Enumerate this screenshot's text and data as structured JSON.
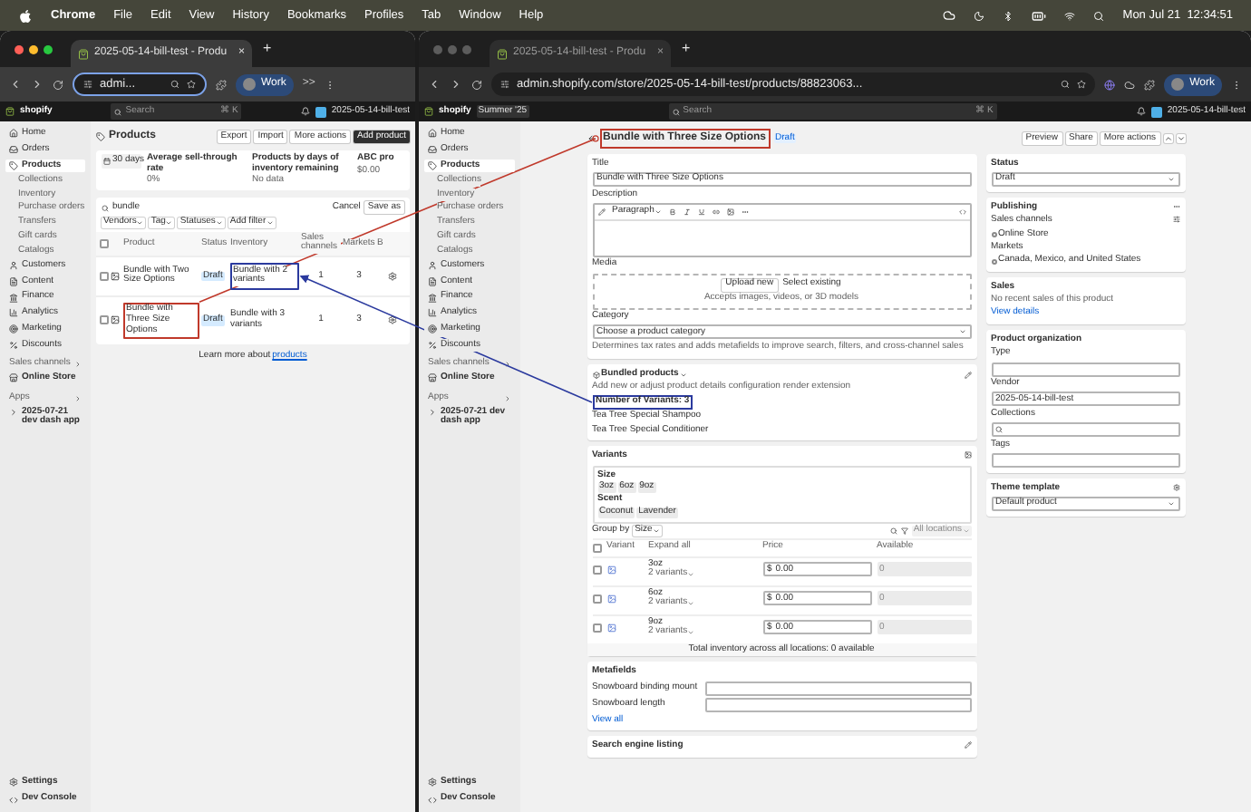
{
  "menu_bar": {
    "app": "Chrome",
    "items": [
      "File",
      "Edit",
      "View",
      "History",
      "Bookmarks",
      "Profiles",
      "Tab",
      "Window",
      "Help"
    ],
    "clock": "Mon Jul 21  12:34:51"
  },
  "left_window": {
    "focused": true,
    "tab_title": "2025-05-14-bill-test - Produ",
    "tab_close": "×",
    "new_tab": "+",
    "address": "admi...",
    "profile": "Work",
    "overflow": ">>",
    "admin_bar": {
      "logo": "shopify",
      "search": "Search",
      "shortcut": "⌘ K",
      "store": "2025-05-14-bill-test"
    },
    "sidebar": {
      "items": [
        {
          "label": "Home",
          "selected": false
        },
        {
          "label": "Orders",
          "selected": false
        },
        {
          "label": "Products",
          "selected": true,
          "children": [
            "Collections",
            "Inventory",
            "Purchase orders",
            "Transfers",
            "Gift cards",
            "Catalogs"
          ]
        },
        {
          "label": "Customers",
          "selected": false
        },
        {
          "label": "Content",
          "selected": false
        },
        {
          "label": "Finance",
          "selected": false
        },
        {
          "label": "Analytics",
          "selected": false
        },
        {
          "label": "Marketing",
          "selected": false
        },
        {
          "label": "Discounts",
          "selected": false
        }
      ],
      "sections": [
        {
          "title": "Sales channels",
          "items": [
            "Online Store"
          ]
        },
        {
          "title": "Apps",
          "items": [
            "2025-07-21 dev dash app"
          ]
        }
      ],
      "footer": [
        "Settings",
        "Dev Console"
      ]
    },
    "page": {
      "title": "Products",
      "actions": [
        "Export",
        "Import",
        "More actions"
      ],
      "primary": "Add product",
      "period": "30 days",
      "metrics": [
        {
          "label": "Average sell-through rate",
          "value": "0%"
        },
        {
          "label": "Products by days of inventory remaining",
          "value": "No data"
        },
        {
          "label": "ABC pro",
          "value": "$0.00"
        }
      ],
      "search": "bundle",
      "cancel": "Cancel",
      "save": "Save as",
      "filters": [
        "Vendors",
        "Tag",
        "Statuses",
        "Add filter"
      ],
      "select_all_checked": false,
      "columns": [
        "Product",
        "Status",
        "Inventory",
        "Sales channels",
        "Markets",
        "B"
      ],
      "rows": [
        {
          "checked": false,
          "product": {
            "text": "Bundle with Two Size Options"
          },
          "status": "Draft",
          "inventory": {
            "text": "Bundle with 2 variants",
            "color": "#2b3a9e"
          },
          "channels": "1",
          "markets": "3"
        },
        {
          "checked": false,
          "product": {
            "text": "Bundle with Three Size Options",
            "color": "#c0392b"
          },
          "status": "Draft",
          "inventory": {
            "text": "Bundle with 3 variants"
          },
          "channels": "1",
          "markets": "3"
        }
      ],
      "footer": "Learn more about",
      "footer_link": "products"
    }
  },
  "right_window": {
    "focused": false,
    "tab_title": "2025-05-14-bill-test - Produ",
    "tab_close": "×",
    "new_tab": "+",
    "address": "admin.shopify.com/store/2025-05-14-bill-test/products/88823063...",
    "profile": "Work",
    "admin_bar": {
      "logo": "shopify",
      "badge": "Summer '25",
      "search": "Search",
      "shortcut": "⌘ K",
      "store": "2025-05-14-bill-test"
    },
    "sidebar": {
      "items": [
        {
          "label": "Home",
          "selected": false
        },
        {
          "label": "Orders",
          "selected": false
        },
        {
          "label": "Products",
          "selected": true,
          "children": [
            "Collections",
            "Inventory",
            "Purchase orders",
            "Transfers",
            "Gift cards",
            "Catalogs"
          ]
        },
        {
          "label": "Customers",
          "selected": false
        },
        {
          "label": "Content",
          "selected": false
        },
        {
          "label": "Finance",
          "selected": false
        },
        {
          "label": "Analytics",
          "selected": false
        },
        {
          "label": "Marketing",
          "selected": false
        },
        {
          "label": "Discounts",
          "selected": false
        }
      ],
      "sections": [
        {
          "title": "Sales channels",
          "items": [
            "Online Store"
          ]
        },
        {
          "title": "Apps",
          "items": [
            "2025-07-21 dev dash app"
          ]
        }
      ],
      "footer": [
        "Settings",
        "Dev Console"
      ]
    },
    "page": {
      "title": {
        "text": "Bundle with Three Size Options",
        "color": "#c0392b"
      },
      "status_badge": "Draft",
      "actions": [
        "Preview",
        "Share",
        "More actions"
      ],
      "title_label": "Title",
      "title_value": "Bundle with Three Size Options",
      "description_label": "Description",
      "editor_style": "Paragraph",
      "media": {
        "label": "Media",
        "upload": "Upload new",
        "select": "Select existing",
        "hint": "Accepts images, videos, or 3D models"
      },
      "category": {
        "label": "Category",
        "placeholder": "Choose a product category",
        "hint": "Determines tax rates and adds metafields to improve search, filters, and cross-channel sales"
      },
      "bundle": {
        "title": "Bundled products",
        "description": "Add new or adjust product details configuration render extension",
        "count": {
          "text": "Number of Variants: 3",
          "color": "#2b3a9e"
        },
        "items": [
          "Tea Tree Special Shampoo",
          "Tea Tree Special Conditioner"
        ]
      },
      "variants": {
        "title": "Variants",
        "options": [
          {
            "name": "Size",
            "values": [
              "3oz",
              "6oz",
              "9oz"
            ]
          },
          {
            "name": "Scent",
            "values": [
              "Coconut",
              "Lavender"
            ]
          }
        ],
        "group_label": "Group by",
        "group_value": "Size",
        "locations": "All locations",
        "select_all_checked": false,
        "columns": [
          "Variant",
          "Expand all",
          "Price",
          "Available"
        ],
        "rows": [
          {
            "checked": false,
            "name": "3oz",
            "count": "2 variants",
            "currency": "$",
            "price": "0.00",
            "available": "0"
          },
          {
            "checked": false,
            "name": "6oz",
            "count": "2 variants",
            "currency": "$",
            "price": "0.00",
            "available": "0"
          },
          {
            "checked": false,
            "name": "9oz",
            "count": "2 variants",
            "currency": "$",
            "price": "0.00",
            "available": "0"
          }
        ],
        "total": "Total inventory across all locations: 0 available"
      },
      "metafields": {
        "title": "Metafields",
        "fields": [
          "Snowboard binding mount",
          "Snowboard length"
        ],
        "link": "View all"
      },
      "seo": {
        "title": "Search engine listing"
      },
      "side": {
        "status_label": "Status",
        "status": "Draft",
        "publishing": "Publishing",
        "channels_label": "Sales channels",
        "channel": "Online Store",
        "markets_label": "Markets",
        "markets": "Canada, Mexico, and United States",
        "sales_title": "Sales",
        "sales_text": "No recent sales of this product",
        "sales_link": "View details",
        "org_title": "Product organization",
        "type_label": "Type",
        "vendor_label": "Vendor",
        "vendor": "2025-05-14-bill-test",
        "collections_label": "Collections",
        "tags_label": "Tags",
        "theme_label": "Theme template",
        "theme": "Default product"
      }
    }
  }
}
